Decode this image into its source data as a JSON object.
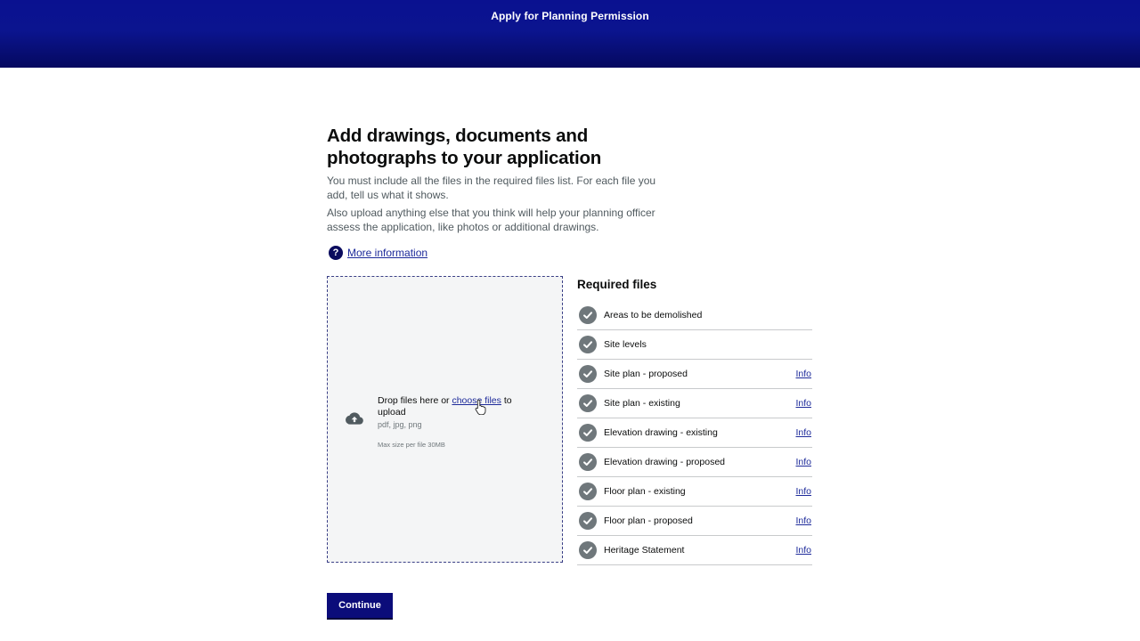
{
  "header": {
    "title": "Apply for Planning Permission"
  },
  "main": {
    "title": "Add drawings, documents and photographs to your application",
    "intro1": "You must include all the files in the required files list. For each file you add, tell us what it shows.",
    "intro2": "Also upload anything else that you think will help your planning officer assess the application, like photos or additional drawings.",
    "more_info_label": "More information"
  },
  "dropzone": {
    "text_before": "Drop files here or ",
    "link_label": "choose files",
    "text_after": " to upload",
    "types": "pdf, jpg, png",
    "max_size": "Max size per file 30MB"
  },
  "required": {
    "title": "Required files",
    "items": [
      {
        "label": "Areas to be demolished",
        "info": ""
      },
      {
        "label": "Site levels",
        "info": ""
      },
      {
        "label": "Site plan - proposed",
        "info": "Info"
      },
      {
        "label": "Site plan - existing",
        "info": "Info"
      },
      {
        "label": "Elevation drawing - existing",
        "info": "Info"
      },
      {
        "label": "Elevation drawing - proposed",
        "info": "Info"
      },
      {
        "label": "Floor plan - existing",
        "info": "Info"
      },
      {
        "label": "Floor plan - proposed",
        "info": "Info"
      },
      {
        "label": "Heritage Statement",
        "info": "Info"
      }
    ]
  },
  "actions": {
    "continue_label": "Continue"
  },
  "colors": {
    "header_blue": "#0a1190",
    "link_blue": "#1d2a9a",
    "button_blue": "#0b0c7a",
    "check_grey": "#6f777b"
  },
  "icons": {
    "help": "help-circle-icon",
    "upload": "cloud-upload-icon",
    "check": "check-circle-icon",
    "cursor": "hand-pointer-icon"
  }
}
